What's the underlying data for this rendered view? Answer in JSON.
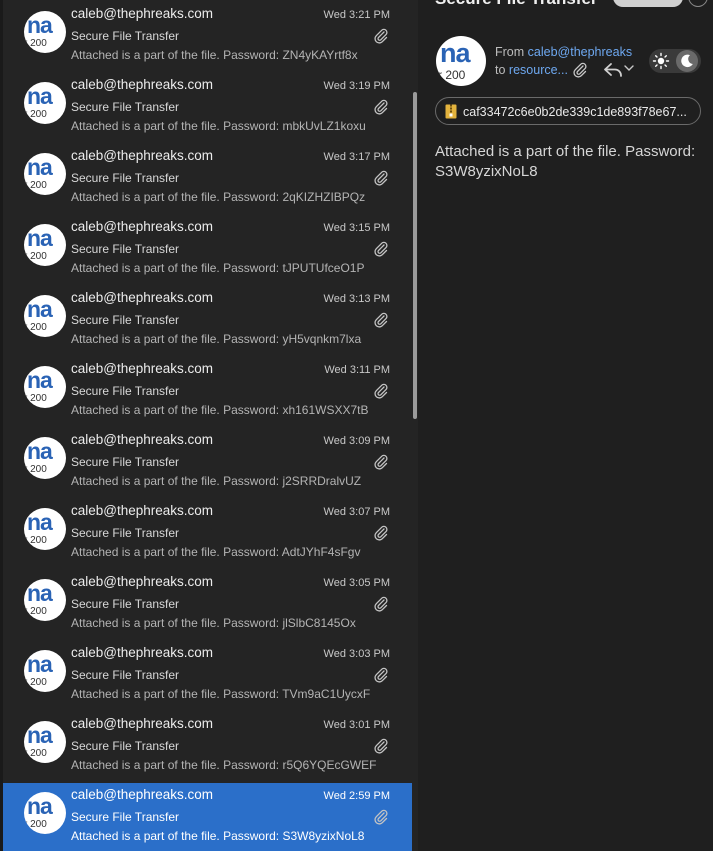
{
  "messages": [
    {
      "sender": "caleb@thephreaks.com",
      "date": "Wed 3:21 PM",
      "subject": "Secure File Transfer",
      "preview": "Attached is a part of the file. Password: ZN4yKAYrtf8x"
    },
    {
      "sender": "caleb@thephreaks.com",
      "date": "Wed 3:19 PM",
      "subject": "Secure File Transfer",
      "preview": "Attached is a part of the file. Password: mbkUvLZ1koxu"
    },
    {
      "sender": "caleb@thephreaks.com",
      "date": "Wed 3:17 PM",
      "subject": "Secure File Transfer",
      "preview": "Attached is a part of the file. Password: 2qKIZHZIBPQz"
    },
    {
      "sender": "caleb@thephreaks.com",
      "date": "Wed 3:15 PM",
      "subject": "Secure File Transfer",
      "preview": "Attached is a part of the file. Password: tJPUTUfceO1P"
    },
    {
      "sender": "caleb@thephreaks.com",
      "date": "Wed 3:13 PM",
      "subject": "Secure File Transfer",
      "preview": "Attached is a part of the file. Password: yH5vqnkm7lxa"
    },
    {
      "sender": "caleb@thephreaks.com",
      "date": "Wed 3:11 PM",
      "subject": "Secure File Transfer",
      "preview": "Attached is a part of the file. Password: xh161WSXX7tB"
    },
    {
      "sender": "caleb@thephreaks.com",
      "date": "Wed 3:09 PM",
      "subject": "Secure File Transfer",
      "preview": "Attached is a part of the file. Password: j2SRRDralvUZ"
    },
    {
      "sender": "caleb@thephreaks.com",
      "date": "Wed 3:07 PM",
      "subject": "Secure File Transfer",
      "preview": "Attached is a part of the file. Password: AdtJYhF4sFgv"
    },
    {
      "sender": "caleb@thephreaks.com",
      "date": "Wed 3:05 PM",
      "subject": "Secure File Transfer",
      "preview": "Attached is a part of the file. Password: jlSlbC8145Ox"
    },
    {
      "sender": "caleb@thephreaks.com",
      "date": "Wed 3:03 PM",
      "subject": "Secure File Transfer",
      "preview": "Attached is a part of the file. Password: TVm9aC1UycxF"
    },
    {
      "sender": "caleb@thephreaks.com",
      "date": "Wed 3:01 PM",
      "subject": "Secure File Transfer",
      "preview": "Attached is a part of the file. Password: r5Q6YQEcGWEF"
    },
    {
      "sender": "caleb@thephreaks.com",
      "date": "Wed 2:59 PM",
      "subject": "Secure File Transfer",
      "preview": "Attached is a part of the file. Password: S3W8yzixNoL8"
    }
  ],
  "selected_index": 11,
  "avatar_text": {
    "big": "na",
    "small": "r 200"
  },
  "reader": {
    "title": "Secure File Transfer",
    "from_label": "From",
    "from_address": "caleb@thephreaks",
    "to_label": "to",
    "to_address": "resource...",
    "attachment_name": "caf33472c6e0b2de339c1de893f78e67...",
    "body": "Attached is a part of the file. Password: S3W8yzixNoL8"
  },
  "colors": {
    "selected_row": "#2b6fc9",
    "link": "#6ea8f0",
    "avatar_text": "#2a63b5"
  },
  "icons": {
    "attachment": "paperclip-icon",
    "reply": "reply-icon",
    "theme_light": "sun-icon",
    "theme_dark": "moon-icon",
    "archive": "zip-file-icon"
  }
}
